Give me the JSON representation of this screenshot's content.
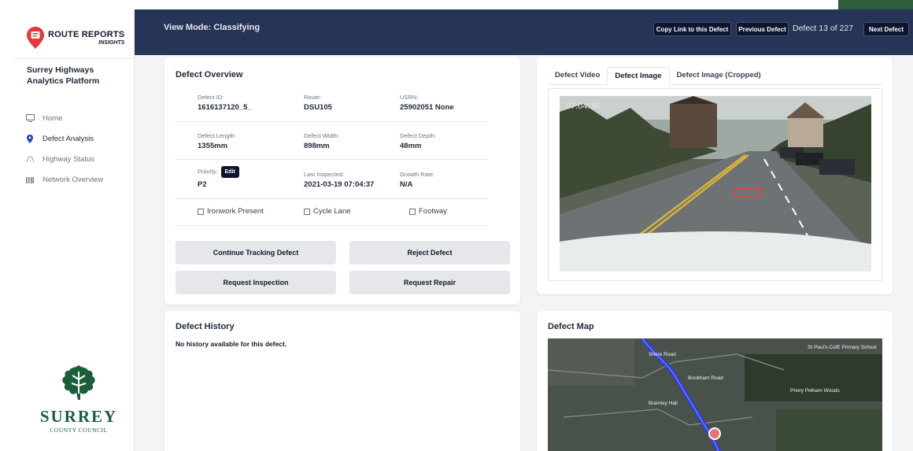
{
  "brand": {
    "logo_line1": "ROUTE REPORTS",
    "logo_line2": "INSIGHTS",
    "platform_name": "Surrey Highways Analytics Platform",
    "council_word": "SURREY",
    "council_sub": "COUNTY COUNCIL"
  },
  "sidebar": {
    "items": [
      {
        "label": "Home",
        "icon": "monitor-icon"
      },
      {
        "label": "Defect Analysis",
        "icon": "map-pin-icon",
        "active": true
      },
      {
        "label": "Highway Status",
        "icon": "road-icon"
      },
      {
        "label": "Network Overview",
        "icon": "bar-grid-icon"
      }
    ]
  },
  "header": {
    "view_mode": "View Mode: Classifying",
    "copy_link": "Copy Link to this Defect",
    "previous": "Previous Defect",
    "counter": "Defect 13 of 227",
    "next": "Next Defect"
  },
  "overview": {
    "title": "Defect Overview",
    "fields": {
      "defect_id": {
        "label": "Defect ID:",
        "value": "1616137120_5_"
      },
      "route": {
        "label": "Route:",
        "value": "DSU105"
      },
      "usrn": {
        "label": "USRN:",
        "value": "25902051 None"
      },
      "length": {
        "label": "Defect Length:",
        "value": "1355mm"
      },
      "width": {
        "label": "Defect Width:",
        "value": "898mm"
      },
      "depth": {
        "label": "Defect Depth:",
        "value": "48mm"
      },
      "priority": {
        "label": "Priority:",
        "value": "P2",
        "edit": "Edit"
      },
      "last_inspected": {
        "label": "Last Inspected:",
        "value": "2021-03-19 07:04:37"
      },
      "growth_rate": {
        "label": "Growth Rate:",
        "value": "N/A"
      }
    },
    "checkboxes": {
      "ironwork": "Ironwork Present",
      "cycle_lane": "Cycle Lane",
      "footway": "Footway"
    },
    "actions": {
      "continue_tracking": "Continue Tracking Defect",
      "reject": "Reject Defect",
      "request_inspection": "Request Inspection",
      "request_repair": "Request Repair"
    }
  },
  "media": {
    "tabs": [
      "Defect Video",
      "Defect Image",
      "Defect Image (Cropped)"
    ],
    "active_tab": "Defect Image",
    "timestamp": "07:04:36"
  },
  "history": {
    "title": "Defect History",
    "message": "No history available for this defect."
  },
  "map": {
    "title": "Defect Map",
    "labels": {
      "a": "St Paul's CofE Primary School",
      "b": "Priory Pelham Woods",
      "c": "Bookham Road",
      "d": "Shere Road",
      "e": "Bramley Hall"
    }
  },
  "colors": {
    "topbar": "#263457",
    "button_dark": "#0b1530",
    "surrey_green": "#1b5e3a",
    "pin_red": "#e53935",
    "route_blue": "#2f3fd6"
  }
}
